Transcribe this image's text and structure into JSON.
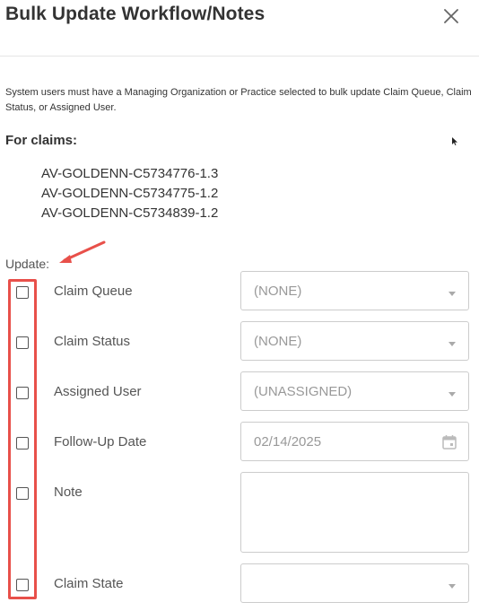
{
  "dialog": {
    "title": "Bulk Update Workflow/Notes",
    "notice": "System users must have a Managing Organization or Practice selected to bulk update Claim Queue, Claim Status, or Assigned User.",
    "for_claims_label": "For claims:",
    "claims": [
      "AV-GOLDENN-C5734776-1.3",
      "AV-GOLDENN-C5734775-1.2",
      "AV-GOLDENN-C5734839-1.2"
    ],
    "update_label": "Update:"
  },
  "fields": {
    "claim_queue": {
      "label": "Claim Queue",
      "value": "(NONE)",
      "checked": false
    },
    "claim_status": {
      "label": "Claim Status",
      "value": "(NONE)",
      "checked": false
    },
    "assigned_user": {
      "label": "Assigned User",
      "value": "(UNASSIGNED)",
      "checked": false
    },
    "follow_up_date": {
      "label": "Follow-Up Date",
      "value": "02/14/2025",
      "checked": false
    },
    "note": {
      "label": "Note",
      "value": "",
      "checked": false
    },
    "claim_state": {
      "label": "Claim State",
      "value": "",
      "checked": false
    }
  },
  "icons": {
    "close": "close-icon",
    "calendar": "calendar-icon",
    "dropdown": "chevron-down-icon",
    "annotation_arrow": "arrow-icon"
  },
  "colors": {
    "annotation": "#e8504a",
    "text": "#333333",
    "muted": "#999999",
    "border": "#cccccc"
  }
}
